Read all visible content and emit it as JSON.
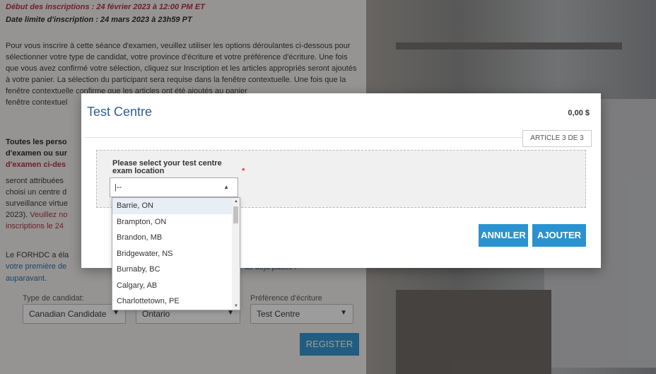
{
  "page": {
    "start_line": "Début des inscriptions : 24 février 2023 à 12:00 PM ET",
    "deadline_line": "Date limite d'inscription : 24 mars 2023 à 23h59 PT",
    "paragraph": "Pour vous inscrire à cette séance d'examen, veuillez utiliser les options déroulantes ci-dessous pour sélectionner votre type de candidat, votre province d'écriture et votre préférence d'écriture. Une fois que vous avez confirmé votre sélection, cliquez sur Inscription et les articles appropriés seront ajoutés à votre panier. La sélection du participant sera requise dans la fenêtre contextuelle. Une fois que la fenêtre contextuelle confirme que les articles ont été ajoutés au panier",
    "paragraph_tail": "fenêtre contextuel",
    "bold_para_1": "Toutes les perso",
    "bold_para_2": "d'examen ou sur",
    "bold_para_3_red": "d'examen ci-des",
    "side_line_1": "seront attribuées",
    "side_line_2": "choisi un centre d",
    "side_line_3": "surveillance virtue",
    "side_line_4": "2023).",
    "side_line_4_red": "Veuillez no",
    "side_line_5_red": "inscriptions le 24",
    "forhdc_line_1": "Le FORHDC a éla",
    "forhdc_line_2_link": "votre première de",
    "forhdc_tail": "as déjà passé l",
    "auparavant": "auparavant.",
    "candidate_type_label": "Type de candidat:",
    "candidate_type_value": "Canadian Candidate",
    "province_value": "Ontario",
    "writing_pref_label": "Préférence d'écriture",
    "writing_pref_value": "Test Centre",
    "register_label": "REGISTER"
  },
  "modal": {
    "title": "Test Centre",
    "price": "0,00 $",
    "article_badge": "ARTICLE 3 DE 3",
    "field_label": "Please select your test centre exam location",
    "required_mark": "*",
    "combo_value": "|--",
    "cancel_label": "ANNULER",
    "add_label": "AJOUTER"
  },
  "dropdown": {
    "options": [
      "Barrie, ON",
      "Brampton, ON",
      "Brandon, MB",
      "Bridgewater, NS",
      "Burnaby, BC",
      "Calgary, AB",
      "Charlottetown, PE"
    ],
    "highlighted_index": 0
  }
}
